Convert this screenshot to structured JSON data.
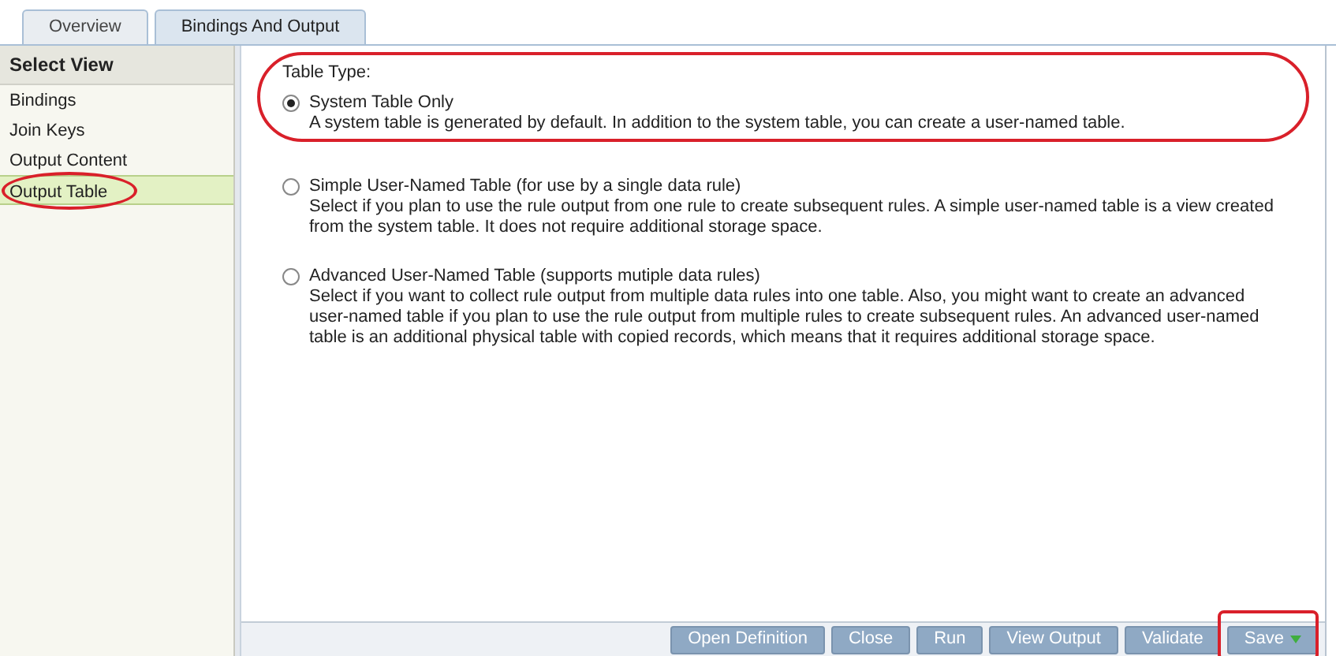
{
  "tabs": [
    {
      "label": "Overview",
      "selected": false
    },
    {
      "label": "Bindings And Output",
      "selected": true
    }
  ],
  "sidebar": {
    "title": "Select View",
    "items": [
      {
        "label": "Bindings",
        "selected": false,
        "circled": false
      },
      {
        "label": "Join Keys",
        "selected": false,
        "circled": false
      },
      {
        "label": "Output Content",
        "selected": false,
        "circled": false
      },
      {
        "label": "Output Table",
        "selected": true,
        "circled": true
      }
    ]
  },
  "table_type": {
    "label": "Table Type:",
    "circled": true,
    "options": [
      {
        "label": "System Table Only",
        "selected": true,
        "description": "A system table is generated by default. In addition to the system table, you can create a user-named table."
      },
      {
        "label": "Simple User-Named Table (for use by a single data rule)",
        "selected": false,
        "description": "Select if you plan to use the rule output from one rule to create subsequent rules. A simple user-named table is a view created from the system table. It does not require additional storage space."
      },
      {
        "label": "Advanced User-Named Table (supports mutiple data rules)",
        "selected": false,
        "description": "Select if you want to collect rule output from multiple data rules into one table. Also, you might want to create an advanced user-named table if you plan to use the rule output from multiple rules to create subsequent rules. An advanced user-named table is an additional physical table with copied records, which means that it requires additional storage space."
      }
    ]
  },
  "buttons": [
    {
      "label": "Open Definition",
      "menu": false,
      "circled": false
    },
    {
      "label": "Close",
      "menu": false,
      "circled": false
    },
    {
      "label": "Run",
      "menu": false,
      "circled": false
    },
    {
      "label": "View Output",
      "menu": false,
      "circled": false
    },
    {
      "label": "Validate",
      "menu": false,
      "circled": false
    },
    {
      "label": "Save",
      "menu": true,
      "circled": true
    }
  ]
}
